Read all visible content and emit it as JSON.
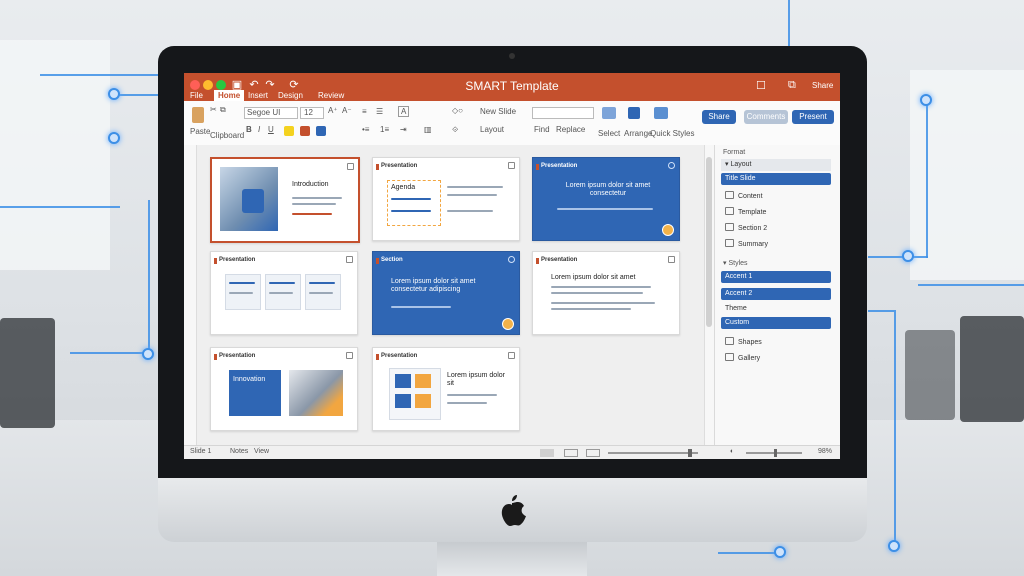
{
  "window": {
    "title": "SMART Template",
    "share_label": "Share"
  },
  "tabs": [
    {
      "label": "File",
      "active": false
    },
    {
      "label": "Home",
      "active": true
    },
    {
      "label": "Insert",
      "active": false
    },
    {
      "label": "Design",
      "active": false
    },
    {
      "label": "Review",
      "active": false
    }
  ],
  "ribbon": {
    "paste_label": "Paste",
    "clipboard_label": "Clipboard",
    "font_name": "Segoe UI",
    "font_size": "12",
    "new_slide_label": "New Slide",
    "layout_label": "Layout",
    "find_label": "Find",
    "replace_label": "Replace",
    "select_label": "Select",
    "arrange_label": "Arrange",
    "styles_label": "Quick Styles",
    "btn_share": "Share",
    "btn_comments": "Comments",
    "btn_present": "Present"
  },
  "slides": [
    {
      "header": "",
      "title": "Introduction",
      "kind": "photo"
    },
    {
      "header": "Presentation",
      "title": "Agenda",
      "kind": "list"
    },
    {
      "header": "Presentation",
      "title": "Lorem ipsum dolor sit amet consectetur",
      "kind": "blue"
    },
    {
      "header": "Presentation",
      "title": "",
      "kind": "cards"
    },
    {
      "header": "Section",
      "title": "Lorem ipsum dolor sit amet consectetur adipiscing",
      "kind": "blue2"
    },
    {
      "header": "Presentation",
      "title": "Lorem ipsum dolor sit amet",
      "kind": "text"
    },
    {
      "header": "Presentation",
      "title": "Innovation",
      "kind": "photo2"
    },
    {
      "header": "Presentation",
      "title": "Lorem ipsum dolor sit",
      "kind": "icons"
    }
  ],
  "pane": {
    "header": "Format",
    "section1": "Layout",
    "items1": [
      "Title Slide",
      "Content",
      "Template",
      "Section 2",
      "Summary"
    ],
    "section2": "Styles",
    "items2": [
      "Accent 1",
      "Accent 2",
      "Theme",
      "Custom"
    ],
    "items3": [
      "Shapes",
      "Gallery"
    ]
  },
  "status": {
    "slide_label": "Slide 1",
    "notes_label": "Notes",
    "view_label": "View",
    "zoom": "98%"
  },
  "colors": {
    "accent": "#c4502d",
    "primary_blue": "#2f66b4"
  }
}
